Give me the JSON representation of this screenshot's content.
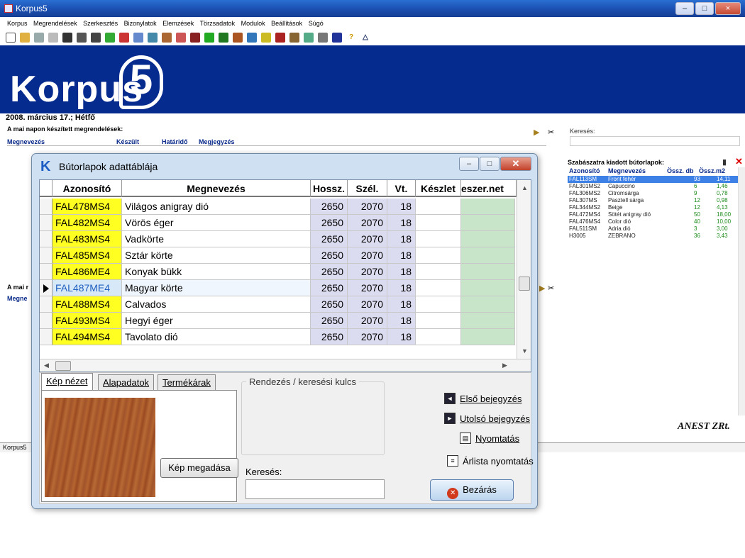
{
  "window": {
    "title": "Korpus5"
  },
  "menubar": [
    "Korpus",
    "Megrendelések",
    "Szerkesztés",
    "Bizonylatok",
    "Elemzések",
    "Törzsadatok",
    "Modulok",
    "Beállítások",
    "Súgó"
  ],
  "banner": {
    "logo_text": "Korpus",
    "logo_digit": "5"
  },
  "main": {
    "date": "2008. március 17.; Hétfő",
    "orders_title": "A mai napon készített megrendelések:",
    "orders_columns": {
      "name": "Megnevezés",
      "made": "Készült",
      "deadline": "Határidő",
      "note": "Megjegyzés"
    },
    "mai_label": "A mai r",
    "megn_label": "Megne",
    "search_label": "Keresés:",
    "status": "Korpus5",
    "company": "ANEST ZRt."
  },
  "cut_panel": {
    "title": "Szabászatra kiadott bútorlapok:",
    "columns": {
      "id": "Azonosító",
      "name": "Megnevezés",
      "count": "Össz. db",
      "area": "Össz.m2"
    },
    "rows": [
      {
        "id": "FAL113SM",
        "name": "Front fehér",
        "count": "93",
        "area": "14,11"
      },
      {
        "id": "FAL301MS2",
        "name": "Capuccino",
        "count": "6",
        "area": "1,46"
      },
      {
        "id": "FAL306MS2",
        "name": "Citromsárga",
        "count": "9",
        "area": "0,78"
      },
      {
        "id": "FAL307MS",
        "name": "Pasztell sárga",
        "count": "12",
        "area": "0,98"
      },
      {
        "id": "FAL344MS2",
        "name": "Beige",
        "count": "12",
        "area": "4,13"
      },
      {
        "id": "FAL472MS4",
        "name": "Sötét anigray dió",
        "count": "50",
        "area": "18,00"
      },
      {
        "id": "FAL476MS4",
        "name": "Color dió",
        "count": "40",
        "area": "10,00"
      },
      {
        "id": "FAL511SM",
        "name": "Adria dió",
        "count": "3",
        "area": "3,00"
      },
      {
        "id": "H3005",
        "name": "ZEBRANO",
        "count": "36",
        "area": "3,43"
      }
    ]
  },
  "dialog": {
    "title": "Bútorlapok adattáblája",
    "logo_glyph": "K",
    "columns": {
      "id": "Azonosító",
      "name": "Megnevezés",
      "length": "Hossz.",
      "width": "Szél.",
      "thickness": "Vt.",
      "stock": "Készlet",
      "net": "eszer.net"
    },
    "rows": [
      {
        "id": "FAL478MS4",
        "name": "Világos anigray dió",
        "length": "2650",
        "width": "2070",
        "thickness": "18"
      },
      {
        "id": "FAL482MS4",
        "name": "Vörös éger",
        "length": "2650",
        "width": "2070",
        "thickness": "18"
      },
      {
        "id": "FAL483MS4",
        "name": "Vadkörte",
        "length": "2650",
        "width": "2070",
        "thickness": "18"
      },
      {
        "id": "FAL485MS4",
        "name": "Sztár körte",
        "length": "2650",
        "width": "2070",
        "thickness": "18"
      },
      {
        "id": "FAL486ME4",
        "name": "Konyak bükk",
        "length": "2650",
        "width": "2070",
        "thickness": "18"
      },
      {
        "id": "FAL487ME4",
        "name": "Magyar körte",
        "length": "2650",
        "width": "2070",
        "thickness": "18"
      },
      {
        "id": "FAL488MS4",
        "name": "Calvados",
        "length": "2650",
        "width": "2070",
        "thickness": "18"
      },
      {
        "id": "FAL493MS4",
        "name": "Hegyi éger",
        "length": "2650",
        "width": "2070",
        "thickness": "18"
      },
      {
        "id": "FAL494MS4",
        "name": "Tavolato dió",
        "length": "2650",
        "width": "2070",
        "thickness": "18"
      }
    ],
    "tabs": {
      "image": "Kép nézet",
      "basic": "Alapadatok",
      "prices": "Termékárak"
    },
    "set_image_button": "Kép megadása",
    "sort_label": "Rendezés / keresési kulcs",
    "search_label": "Keresés:",
    "first_record": "Első bejegyzés",
    "last_record": "Utolsó bejegyzés",
    "print": "Nyomtatás",
    "price_list_print": "Árlista nyomtatás",
    "close_button": "Bezárás"
  },
  "colors": {
    "banner": "#062b8f",
    "id_highlight": "#ffff22",
    "net_column": "#c9e5c9",
    "selection": "#3d80e6"
  }
}
